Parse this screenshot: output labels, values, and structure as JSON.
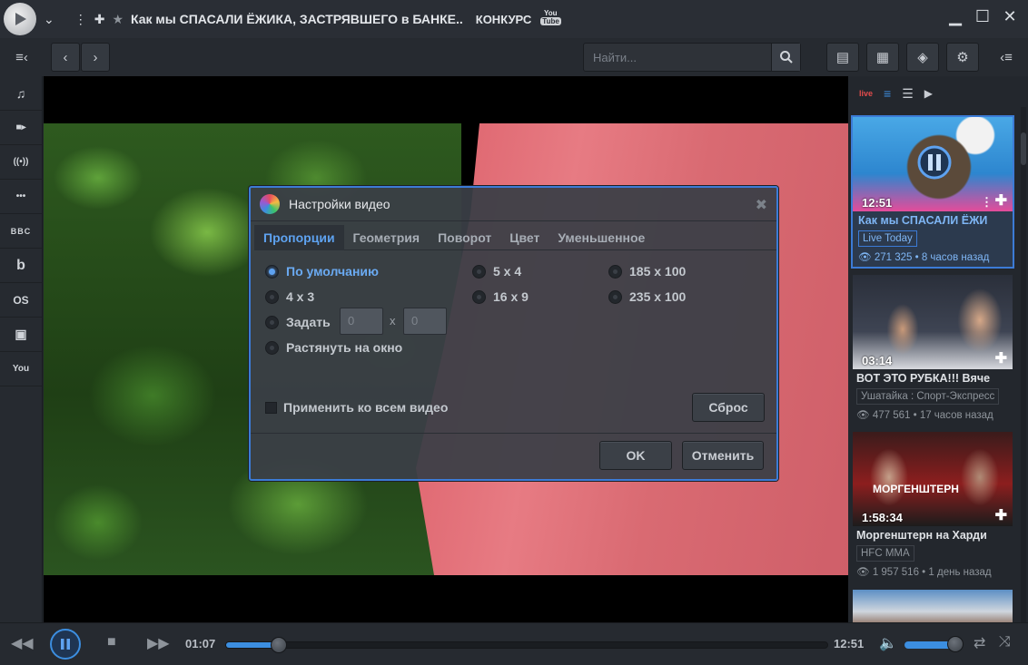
{
  "titlebar": {
    "title": "Как мы СПАСАЛИ ЁЖИКА, ЗАСТРЯВШЕГО в БАНКЕ..",
    "subtitle": "КОНКУРС",
    "yt_top": "You",
    "yt_bottom": "Tube"
  },
  "toolbar": {
    "search_placeholder": "Найти..."
  },
  "leftbar": {
    "items": [
      {
        "name": "music-icon",
        "glyph": "♫"
      },
      {
        "name": "video-camera-icon",
        "glyph": "■▸"
      },
      {
        "name": "broadcast-icon",
        "glyph": "((•))"
      },
      {
        "name": "more-icon",
        "glyph": "•••"
      },
      {
        "name": "bbc-icon",
        "glyph": "BBC"
      },
      {
        "name": "b-icon",
        "glyph": "b"
      },
      {
        "name": "lastfm-icon",
        "glyph": "OS"
      },
      {
        "name": "twitch-icon",
        "glyph": "▣"
      },
      {
        "name": "youtube-icon",
        "glyph": "You"
      }
    ]
  },
  "dialog": {
    "title": "Настройки видео",
    "tabs": [
      "Пропорции",
      "Геометрия",
      "Поворот",
      "Цвет",
      "Уменьшенное"
    ],
    "options": {
      "default": "По умолчанию",
      "r4x3": "4 x 3",
      "custom": "Задать",
      "stretch": "Растянуть на окно",
      "r5x4": "5 x 4",
      "r16x9": "16 x 9",
      "r185x100": "185 x 100",
      "r235x100": "235 x 100"
    },
    "custom_w": "0",
    "custom_h": "0",
    "x_sep": "x",
    "apply_all": "Применить ко всем видео",
    "reset": "Сброс",
    "ok": "OK",
    "cancel": "Отменить"
  },
  "playlist": {
    "tabs": [
      "live",
      "≡",
      "☰",
      "▶"
    ],
    "items": [
      {
        "duration": "12:51",
        "title": "Как мы СПАСАЛИ ЁЖИ",
        "channel": "Live Today",
        "views": "271 325",
        "age": "8 часов назад"
      },
      {
        "duration": "03:14",
        "title": "ВОТ ЭТО РУБКА!!! Вяче",
        "channel": "Ушатайка : Спорт-Экспресс",
        "views": "477 561",
        "age": "17 часов назад"
      },
      {
        "duration": "1:58:34",
        "title": "Моргенштерн на Харди",
        "channel": "HFC MMA",
        "views": "1 957 516",
        "age": "1 день назад"
      }
    ]
  },
  "player": {
    "current_time": "01:07",
    "total_time": "12:51",
    "progress": 0.087,
    "volume": 0.9
  },
  "colors": {
    "accent": "#3c8ee0",
    "active_tab": "#5ea2f0"
  }
}
